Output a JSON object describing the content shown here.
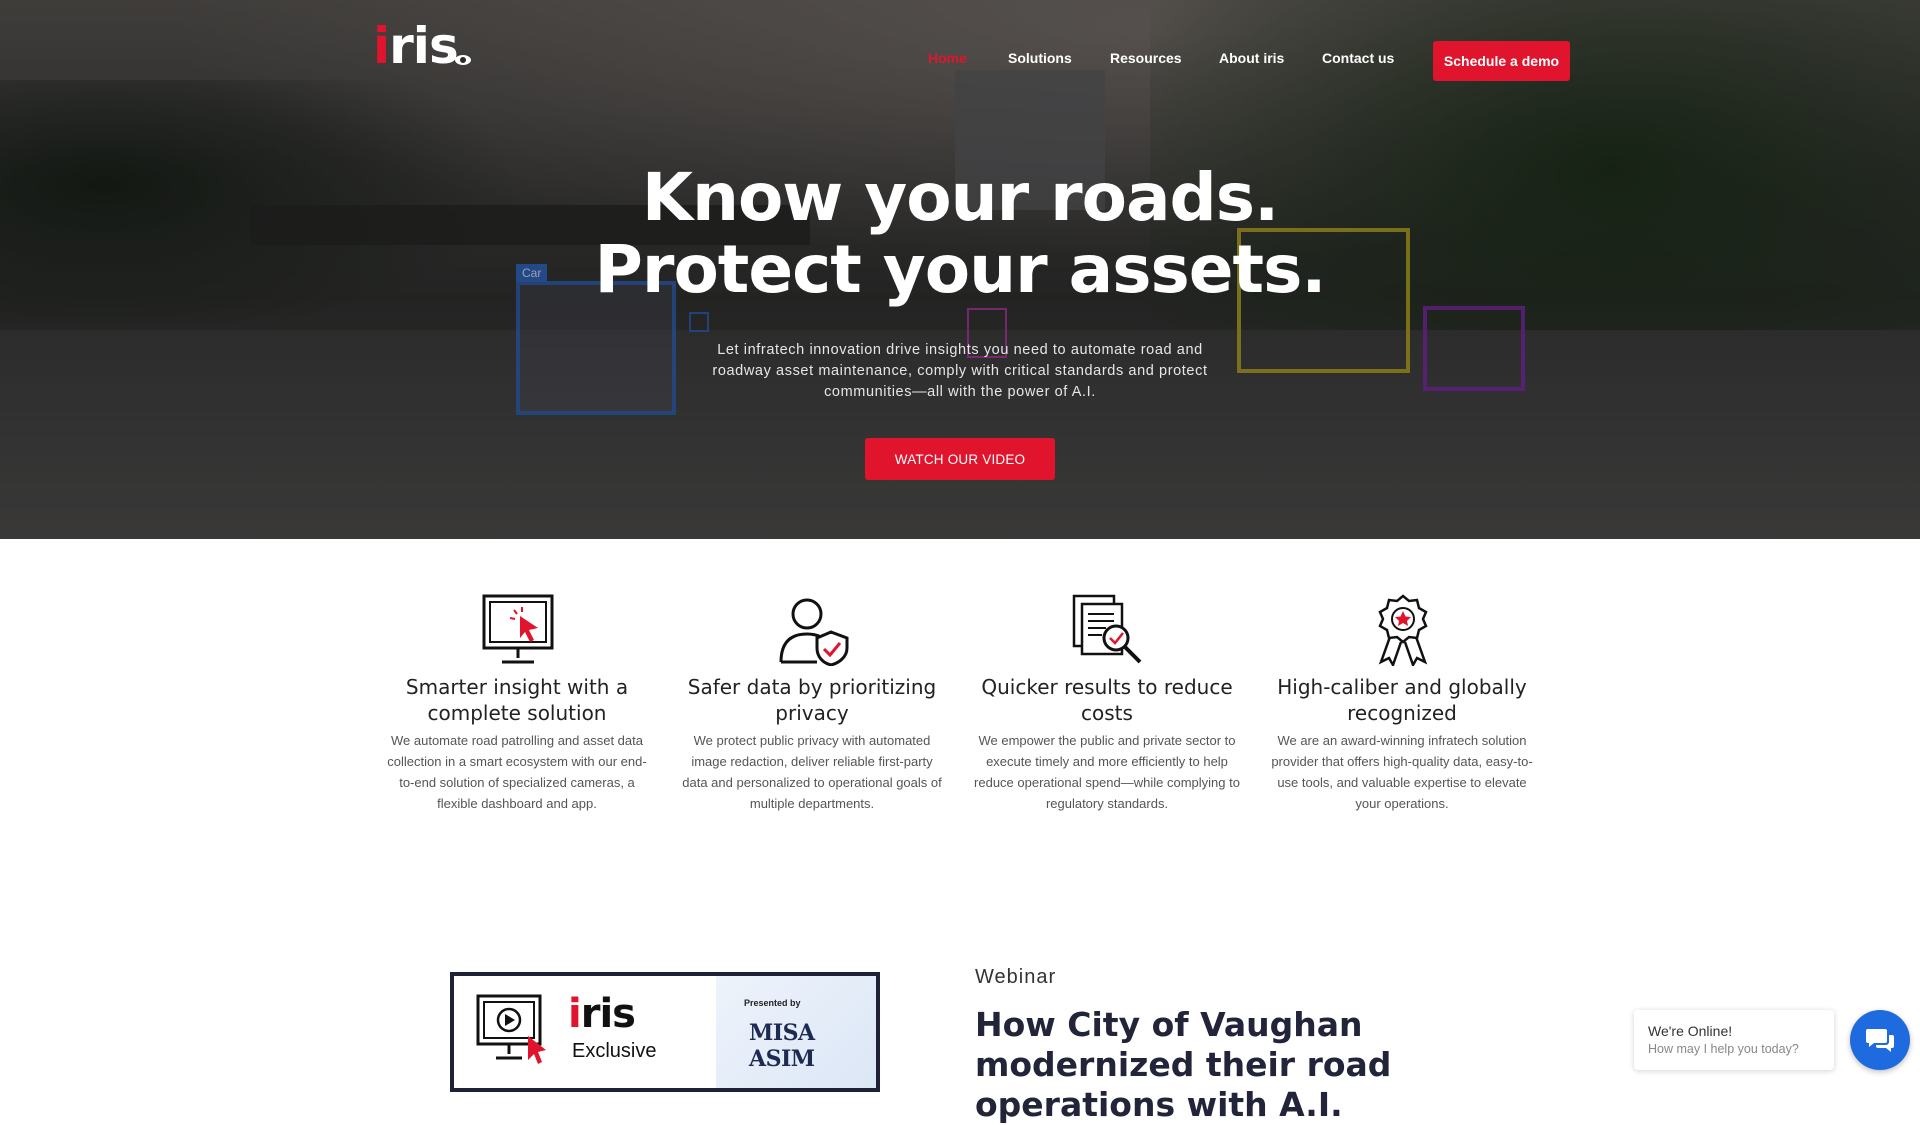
{
  "brand": {
    "logo_first": "i",
    "logo_rest": "ris",
    "accent": "#e0152d"
  },
  "nav": {
    "items": [
      {
        "label": "Home",
        "active": true
      },
      {
        "label": "Solutions",
        "active": false
      },
      {
        "label": "Resources",
        "active": false
      },
      {
        "label": "About iris",
        "active": false
      },
      {
        "label": "Contact us",
        "active": false
      }
    ],
    "cta_label": "Schedule a demo"
  },
  "hero": {
    "title_line1": "Know your roads.",
    "title_line2": "Protect your assets.",
    "subtitle": "Let infratech innovation drive insights you need to automate road and roadway asset maintenance, comply with critical standards and protect communities—all with the power of A.I.",
    "button_label": "WATCH OUR VIDEO",
    "detection_tag": "Car"
  },
  "features": [
    {
      "icon": "monitor-cursor-icon",
      "title": "Smarter insight with a complete solution",
      "text": "We automate road patrolling and asset data collection in a smart ecosystem with our end-to-end solution of specialized cameras, a flexible dashboard and app."
    },
    {
      "icon": "user-shield-icon",
      "title": "Safer data by prioritizing privacy",
      "text": "We protect public privacy with automated image redaction, deliver reliable first-party data and personalized to operational goals of multiple departments."
    },
    {
      "icon": "document-search-icon",
      "title": "Quicker results to reduce costs",
      "text": "We empower the public and private sector to execute timely and more efficiently to help reduce operational spend—while complying to regulatory standards."
    },
    {
      "icon": "award-ribbon-icon",
      "title": "High-caliber and globally recognized",
      "text": "We are an award-winning infratech solution provider that offers high-quality data, easy-to-use tools, and valuable expertise to elevate your operations."
    }
  ],
  "webinar": {
    "card_logo_first": "i",
    "card_logo_rest": "ris",
    "card_exclusive": "Exclusive",
    "card_presented_by": "Presented by",
    "card_partner": "MISA ASIM",
    "label": "Webinar",
    "title": "How City of Vaughan modernized their road operations with A.I."
  },
  "chat": {
    "title": "We're Online!",
    "subtitle": "How may I help you today?",
    "color": "#1e6be0"
  }
}
